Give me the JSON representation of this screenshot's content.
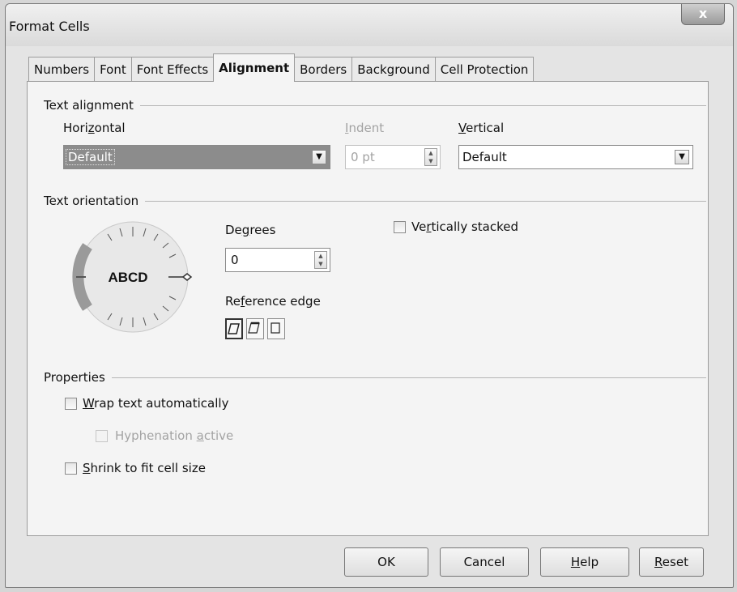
{
  "window": {
    "title": "Format Cells",
    "close_label": "x"
  },
  "tabs": [
    {
      "label": "Numbers"
    },
    {
      "label": "Font"
    },
    {
      "label": "Font Effects"
    },
    {
      "label": "Alignment",
      "active": true
    },
    {
      "label": "Borders"
    },
    {
      "label": "Background"
    },
    {
      "label": "Cell Protection"
    }
  ],
  "text_alignment": {
    "heading": "Text alignment",
    "horizontal": {
      "label_pre": "Hori",
      "label_key": "z",
      "label_post": "ontal",
      "value": "Default"
    },
    "indent": {
      "label_key": "I",
      "label_post": "ndent",
      "value": "0 pt"
    },
    "vertical": {
      "label_key": "V",
      "label_post": "ertical",
      "value": "Default"
    }
  },
  "text_orientation": {
    "heading": "Text orientation",
    "dial_text": "ABCD",
    "degrees": {
      "label_pre": "De",
      "label_key": "g",
      "label_post": "rees",
      "value": "0"
    },
    "reference_edge": {
      "label_pre": "Re",
      "label_key": "f",
      "label_post": "erence edge"
    },
    "vertically_stacked": {
      "label_pre": "Ve",
      "label_key": "r",
      "label_post": "tically stacked",
      "checked": false
    }
  },
  "properties": {
    "heading": "Properties",
    "wrap": {
      "label_key": "W",
      "label_post": "rap text automatically",
      "checked": false
    },
    "hyphenation": {
      "label_pre": "Hyphenation ",
      "label_key": "a",
      "label_post": "ctive",
      "checked": false
    },
    "shrink": {
      "label_key": "S",
      "label_post": "hrink to fit cell size",
      "checked": false
    }
  },
  "buttons": {
    "ok": "OK",
    "cancel": "Cancel",
    "help_key": "H",
    "help_post": "elp",
    "reset_key": "R",
    "reset_post": "eset"
  },
  "icons": {
    "dropdown": "▼",
    "spin_up": "▲",
    "spin_down": "▼"
  }
}
